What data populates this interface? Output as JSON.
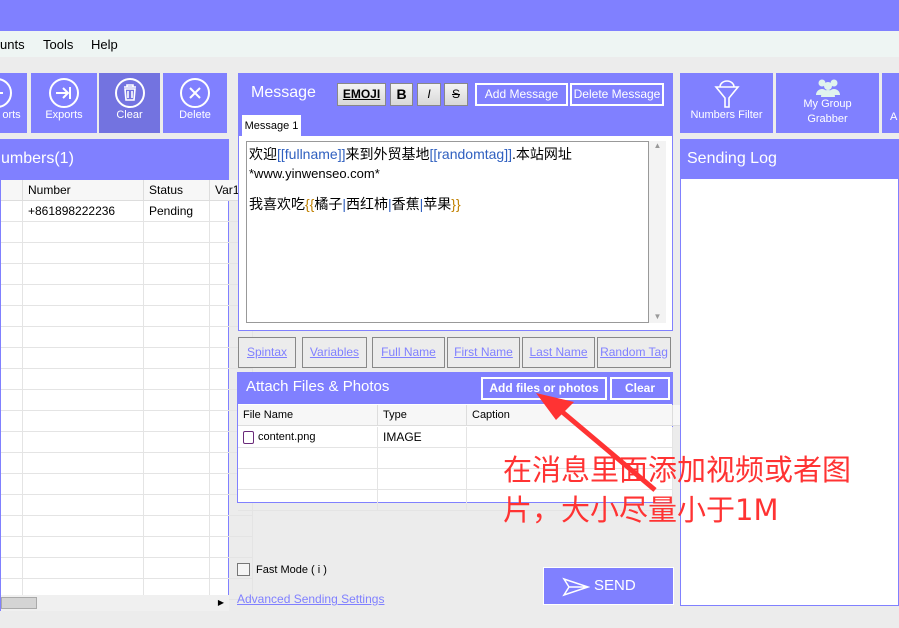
{
  "menu": [
    "unts",
    "Tools",
    "Help"
  ],
  "left_toolbar": [
    {
      "label": "orts",
      "icon": "import-icon"
    },
    {
      "label": "Exports",
      "icon": "export-icon"
    },
    {
      "label": "Clear",
      "icon": "trash-icon"
    },
    {
      "label": "Delete",
      "icon": "close-circle-icon"
    }
  ],
  "numbers_panel": {
    "title": "umbers(1)",
    "columns": [
      "",
      "Number",
      "Status",
      "Var1"
    ],
    "rows": [
      [
        "",
        "+861898222236",
        "Pending",
        ""
      ]
    ]
  },
  "message": {
    "title": "Message",
    "emoji": "EMOJI",
    "bold": "B",
    "italic": "I",
    "strike": "S",
    "add": "Add Message",
    "delete": "Delete Message",
    "tab": "Message 1",
    "line1_a": "欢迎",
    "line1_b": "[[fullname]]",
    "line1_c": "来到外贸基地",
    "line1_d": "[[randomtag]]",
    "line1_e": ".本站网址",
    "line2": "*www.yinwenseo.com*",
    "line3_a": "我喜欢吃",
    "line3_b": "{{",
    "line3_c": "橘子",
    "line3_d": "|",
    "line3_e": "西红柿",
    "line3_f": "|",
    "line3_g": "香蕉",
    "line3_h": "|",
    "line3_i": "苹果",
    "line3_j": "}}"
  },
  "tags": [
    "Spintax",
    "Variables",
    "Full Name",
    "First Name",
    "Last Name",
    "Random Tag"
  ],
  "attach": {
    "title": "Attach Files & Photos",
    "add": "Add files or photos",
    "clear": "Clear",
    "columns": [
      "File Name",
      "Type",
      "Caption"
    ],
    "rows": [
      [
        "content.png",
        "IMAGE",
        ""
      ]
    ]
  },
  "fast_mode": "Fast Mode ( i )",
  "advanced": "Advanced Sending Settings",
  "send": "SEND",
  "right_toolbar": [
    {
      "label": "Numbers Filter",
      "icon": "funnel-icon"
    },
    {
      "label": "My Group Grabber",
      "icon": "group-icon"
    },
    {
      "label": "A"
    }
  ],
  "sending_log": "Sending Log",
  "annotation": {
    "line1": "在消息里面添加视频或者图",
    "line2": "片，大小尽量小于1M",
    "color": "#ff3333"
  }
}
